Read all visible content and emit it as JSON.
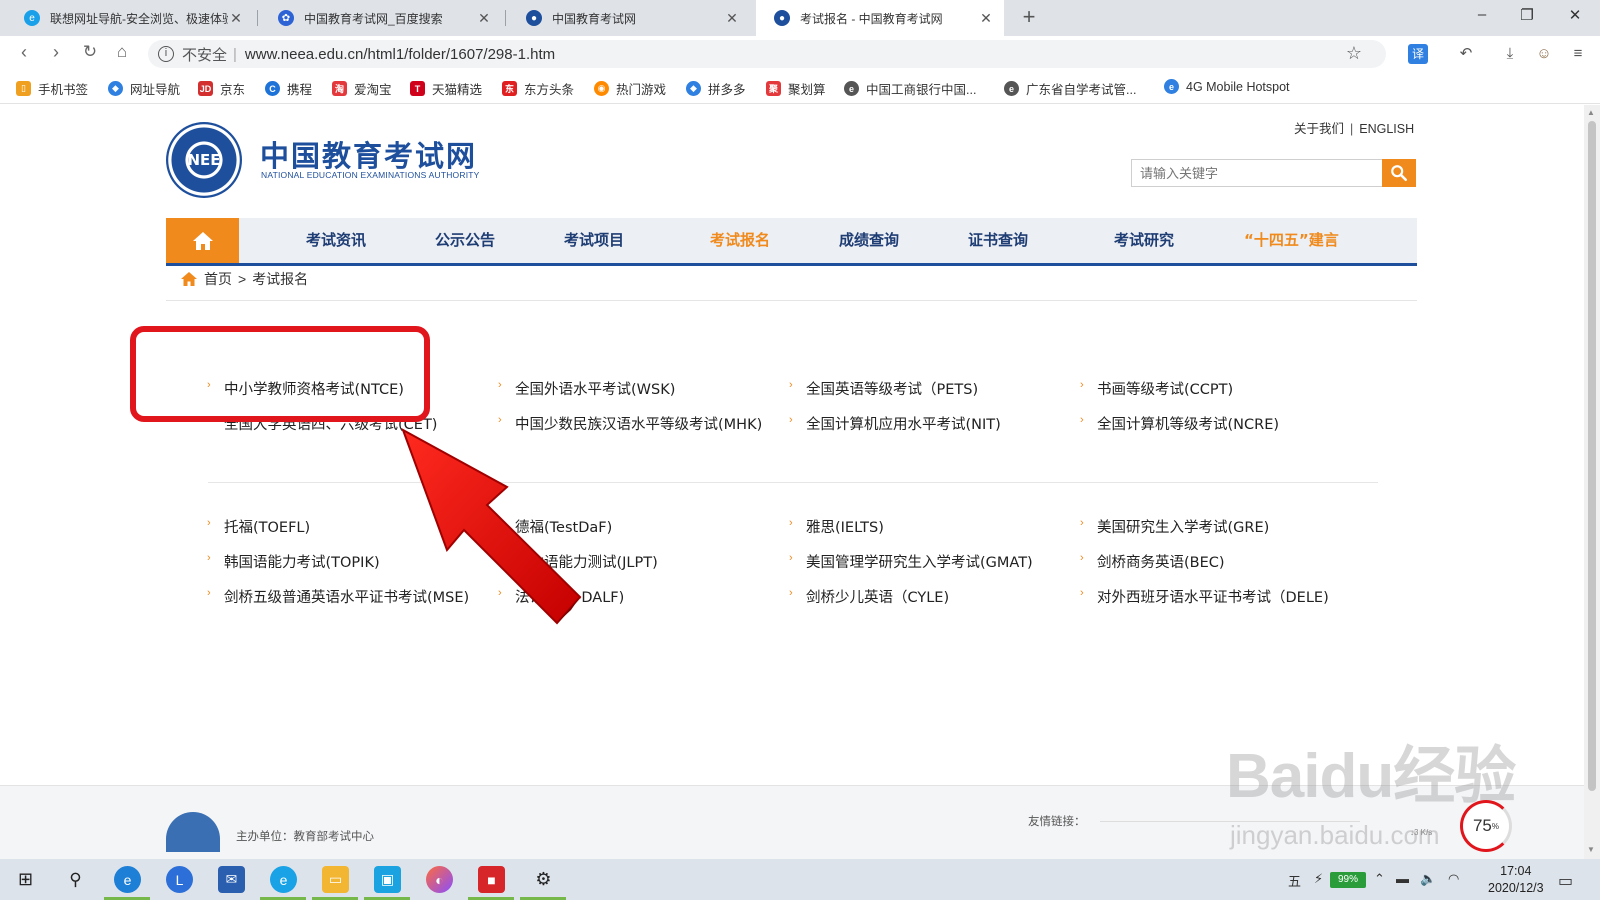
{
  "browser": {
    "tabs": [
      {
        "title": "联想网址导航-安全浏览、极速体验",
        "active": false
      },
      {
        "title": "中国教育考试网_百度搜索",
        "active": false
      },
      {
        "title": "中国教育考试网",
        "active": false
      },
      {
        "title": "考试报名 - 中国教育考试网",
        "active": true
      }
    ],
    "new_tab": "+",
    "security_label": "不安全",
    "url": "www.neea.edu.cn/html1/folder/1607/298-1.htm",
    "bookmarks": [
      "手机书签",
      "网址导航",
      "京东",
      "携程",
      "爱淘宝",
      "天猫精选",
      "东方头条",
      "热门游戏",
      "拼多多",
      "聚划算",
      "中国工商银行中国...",
      "广东省自学考试管...",
      "4G Mobile Hotspot"
    ]
  },
  "site": {
    "logo_text": "NEE",
    "title": "中国教育考试网",
    "subtitle": "NATIONAL EDUCATION EXAMINATIONS AUTHORITY",
    "top_links": {
      "about": "关于我们",
      "sep": "|",
      "english": "ENGLISH"
    },
    "search_placeholder": "请输入关键字",
    "nav": [
      {
        "label": "考试资讯",
        "highlight": false
      },
      {
        "label": "公示公告",
        "highlight": false
      },
      {
        "label": "考试项目",
        "highlight": false
      },
      {
        "label": "考试报名",
        "highlight": true
      },
      {
        "label": "成绩查询",
        "highlight": false
      },
      {
        "label": "证书查询",
        "highlight": false
      },
      {
        "label": "考试研究",
        "highlight": false
      },
      {
        "label": "“十四五”建言",
        "highlight": true
      }
    ],
    "breadcrumb": {
      "home": "首页",
      "sep": ">",
      "current": "考试报名"
    }
  },
  "exams": {
    "domestic": [
      "中小学教师资格考试(NTCE)",
      "全国外语水平考试(WSK)",
      "全国英语等级考试（PETS)",
      "书画等级考试(CCPT)",
      "全国大学英语四、六级考试(CET)",
      "中国少数民族汉语水平等级考试(MHK)",
      "全国计算机应用水平考试(NIT)",
      "全国计算机等级考试(NCRE)"
    ],
    "international": [
      "托福(TOEFL)",
      "德福(TestDaF)",
      "雅思(IELTS)",
      "美国研究生入学考试(GRE)",
      "韩国语能力考试(TOPIK)",
      "日本语能力测试(JLPT)",
      "美国管理学研究生入学考试(GMAT)",
      "剑桥商务英语(BEC)",
      "剑桥五级普通英语水平证书考试(MSE)",
      "法语(TCF-DALF)",
      "剑桥少儿英语（CYLE)",
      "对外西班牙语水平证书考试（DELE)"
    ]
  },
  "footer": {
    "sponsor": "主办单位：教育部考试中心",
    "friend_links": "友情链接："
  },
  "overlay": {
    "watermark": "Baidu经验",
    "watermark_url": "jingyan.baidu.com",
    "speed_percent": "75",
    "speed_unit": "%",
    "net_speed": "↓3 K/s"
  },
  "taskbar": {
    "ime": "五",
    "battery": "99%",
    "time": "17:04",
    "date": "2020/12/3"
  },
  "colors": {
    "brand_blue": "#1e4f9c",
    "accent_orange": "#f08a1c",
    "highlight_red": "#e0161c"
  }
}
